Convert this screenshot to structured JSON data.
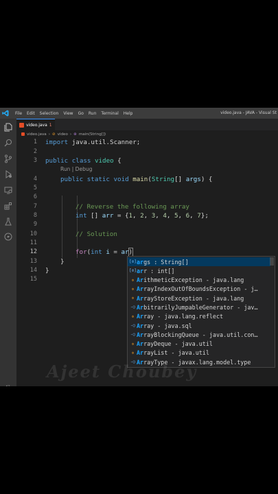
{
  "app": {
    "window_title": "video.java - JAVA - Visual St",
    "menu": [
      "File",
      "Edit",
      "Selection",
      "View",
      "Go",
      "Run",
      "Terminal",
      "Help"
    ]
  },
  "activity_bar": {
    "icons": [
      "files-icon",
      "search-icon",
      "source-control-icon",
      "run-debug-icon",
      "remote-explorer-icon",
      "extensions-icon",
      "testing-icon",
      "lightning-icon",
      "settings-gear-icon"
    ]
  },
  "tab": {
    "label": "video.java",
    "badge": "1"
  },
  "breadcrumb": {
    "file": "video.java",
    "class": "video",
    "method": "main(String[])"
  },
  "editor": {
    "line_numbers": [
      "1",
      "2",
      "3",
      "",
      "4",
      "5",
      "6",
      "7",
      "8",
      "9",
      "10",
      "11",
      "12",
      "13",
      "14",
      "15"
    ],
    "codelens": "Run | Debug",
    "lines": {
      "l1": [
        "import",
        " java.util.Scanner;"
      ],
      "l3": [
        "public",
        " ",
        "class",
        " ",
        "video",
        " {"
      ],
      "l4": [
        "public",
        " ",
        "static",
        " ",
        "void",
        " ",
        "main",
        "(",
        "String",
        "[] ",
        "args",
        ") {"
      ],
      "l7": "// Reverse the following array",
      "l8": [
        "int",
        " [] ",
        "arr",
        " = {",
        "1",
        ", ",
        "2",
        ", ",
        "3",
        ", ",
        "4",
        ", ",
        "5",
        ", ",
        "6",
        ", ",
        "7",
        "};"
      ],
      "l10": "// Solution",
      "l12": [
        "for",
        "(",
        "int",
        " ",
        "i",
        " = ",
        "ar",
        ")"
      ],
      "l13": "}",
      "l14": "}"
    }
  },
  "suggest": {
    "items": [
      {
        "kind": "var",
        "match": "ar",
        "rest": "gs : String[]"
      },
      {
        "kind": "var",
        "match": "ar",
        "rest": "r : int[]"
      },
      {
        "kind": "cls",
        "match": "Ar",
        "rest": "ithmeticException - java.lang"
      },
      {
        "kind": "cls",
        "match": "Ar",
        "rest": "rayIndexOutOfBoundsException - j…"
      },
      {
        "kind": "cls",
        "match": "Ar",
        "rest": "rayStoreException - java.lang"
      },
      {
        "kind": "cls",
        "match": "Ar",
        "rest": "bitrarilyJumpableGenerator - jav…"
      },
      {
        "kind": "cls",
        "match": "Ar",
        "rest": "ray - java.lang.reflect"
      },
      {
        "kind": "cls",
        "match": "Ar",
        "rest": "ray - java.sql"
      },
      {
        "kind": "cls",
        "match": "Ar",
        "rest": "rayBlockingQueue - java.util.con…"
      },
      {
        "kind": "cls",
        "match": "Ar",
        "rest": "rayDeque - java.util"
      },
      {
        "kind": "cls",
        "match": "Ar",
        "rest": "rayList - java.util"
      },
      {
        "kind": "cls",
        "match": "Ar",
        "rest": "rayType - javax.lang.model.type"
      }
    ]
  },
  "watermark": "Ajeet Choubey",
  "colors": {
    "accent": "#3794ff",
    "selection": "#04395e",
    "keyword": "#569cd6",
    "comment": "#6a9955"
  }
}
